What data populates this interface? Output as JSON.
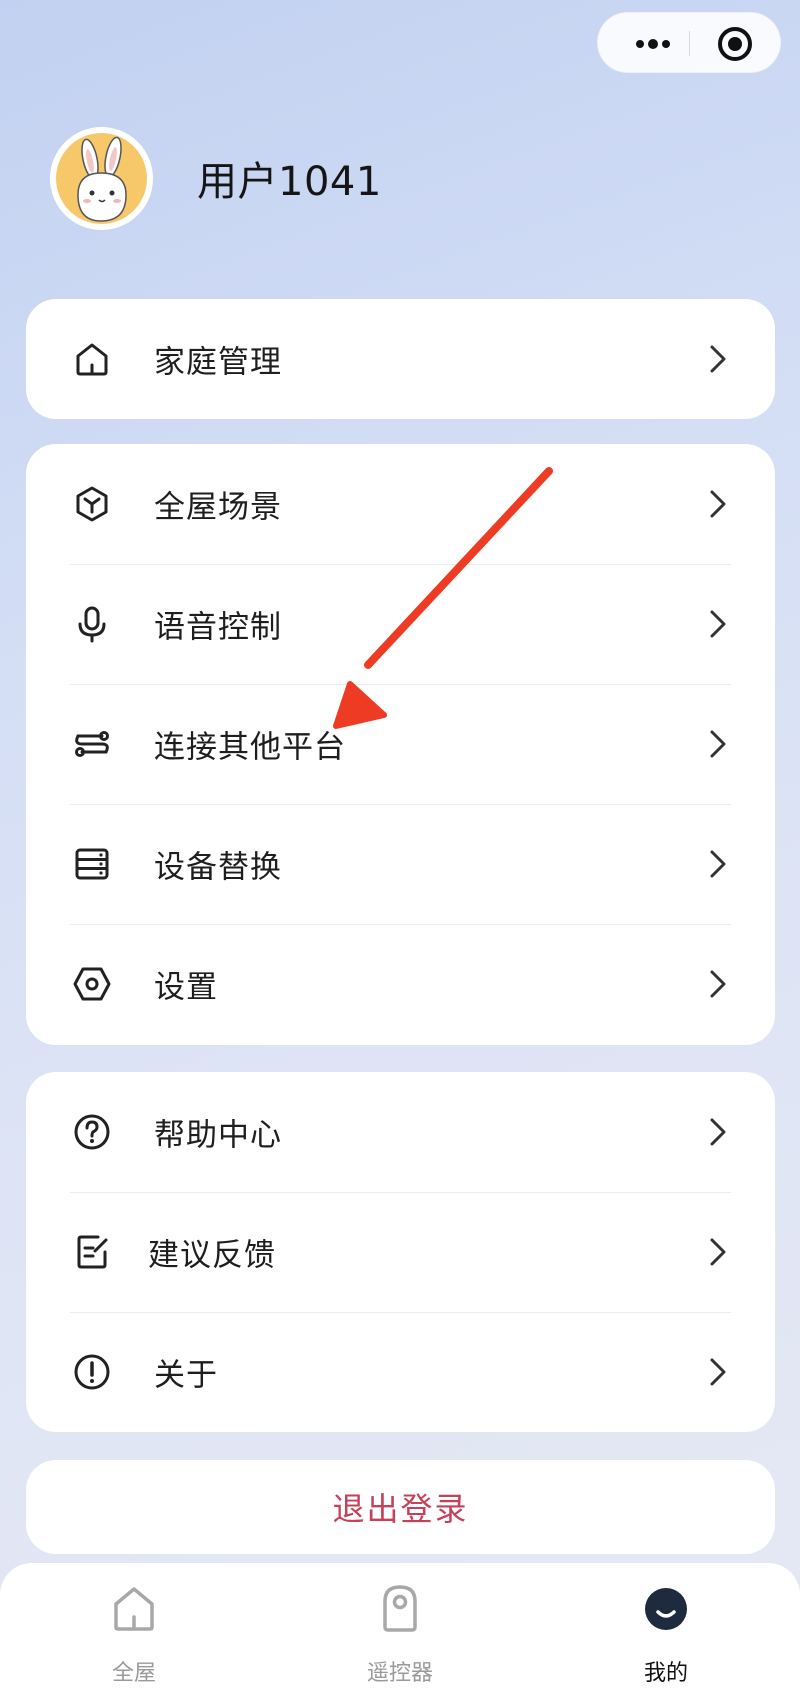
{
  "profile": {
    "username": "用户1041"
  },
  "menu_group_1": [
    {
      "label": "家庭管理",
      "icon": "home-icon"
    }
  ],
  "menu_group_2": [
    {
      "label": "全屋场景",
      "icon": "cube-icon"
    },
    {
      "label": "语音控制",
      "icon": "microphone-icon"
    },
    {
      "label": "连接其他平台",
      "icon": "connect-icon"
    },
    {
      "label": "设备替换",
      "icon": "device-replace-icon"
    },
    {
      "label": "设置",
      "icon": "settings-icon"
    }
  ],
  "menu_group_3": [
    {
      "label": "帮助中心",
      "icon": "help-icon"
    },
    {
      "label": "建议反馈",
      "icon": "feedback-icon"
    },
    {
      "label": "关于",
      "icon": "about-icon"
    }
  ],
  "logout_label": "退出登录",
  "tabbar": [
    {
      "label": "全屋",
      "icon": "house-tab-icon",
      "active": false
    },
    {
      "label": "遥控器",
      "icon": "remote-tab-icon",
      "active": false
    },
    {
      "label": "我的",
      "icon": "profile-tab-icon",
      "active": true
    }
  ],
  "colors": {
    "logout_text": "#c6405a",
    "annotation_arrow": "#ee3b24",
    "active_tab_icon": "#1e2a3d"
  }
}
